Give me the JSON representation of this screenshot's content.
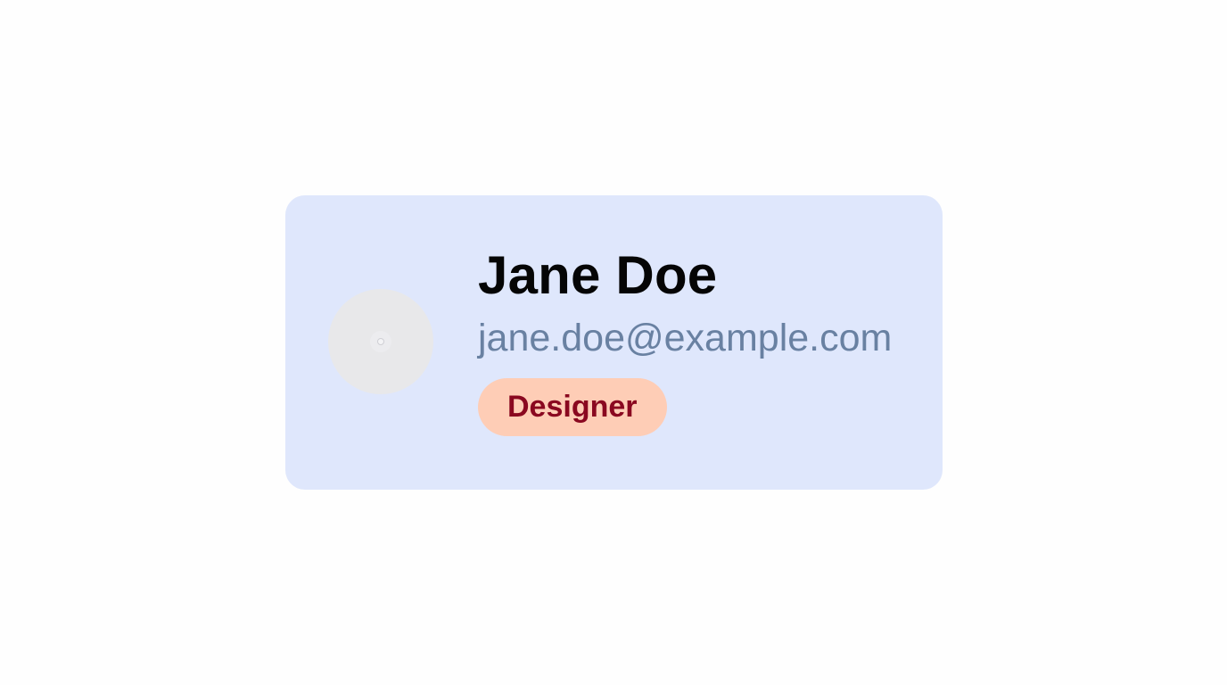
{
  "profile": {
    "name": "Jane Doe",
    "email": "jane.doe@example.com",
    "role": "Designer",
    "avatar_icon": "user-avatar-placeholder-icon"
  },
  "colors": {
    "page_background": "#fefefe",
    "card_background": "#dfe7fc",
    "name_text": "#050505",
    "email_text": "#6981a2",
    "badge_background": "#fecdb6",
    "badge_text": "#8a0820",
    "avatar_background": "#e8e8ea"
  }
}
